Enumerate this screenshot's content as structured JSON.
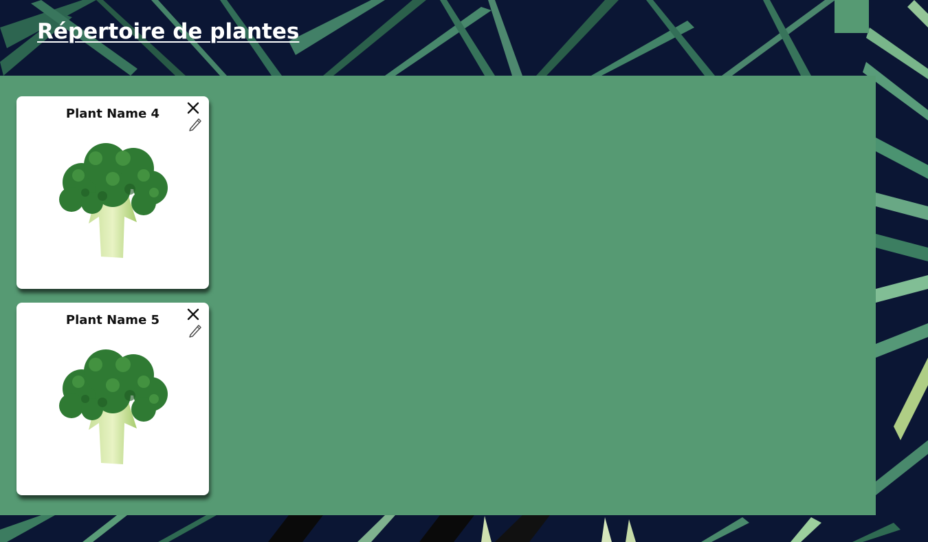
{
  "header": {
    "title": "Répertoire de plantes",
    "menu_icon": "menu-square-icon"
  },
  "colors": {
    "panel": "#569a73",
    "background": "#0b1634",
    "card": "#ffffff",
    "leaf": "#3f7f62"
  },
  "plants": [
    {
      "name": "Plant Name 4",
      "image": "broccoli-image",
      "close_icon": "close-icon",
      "edit_icon": "pencil-icon"
    },
    {
      "name": "Plant Name 5",
      "image": "broccoli-image",
      "close_icon": "close-icon",
      "edit_icon": "pencil-icon"
    }
  ]
}
